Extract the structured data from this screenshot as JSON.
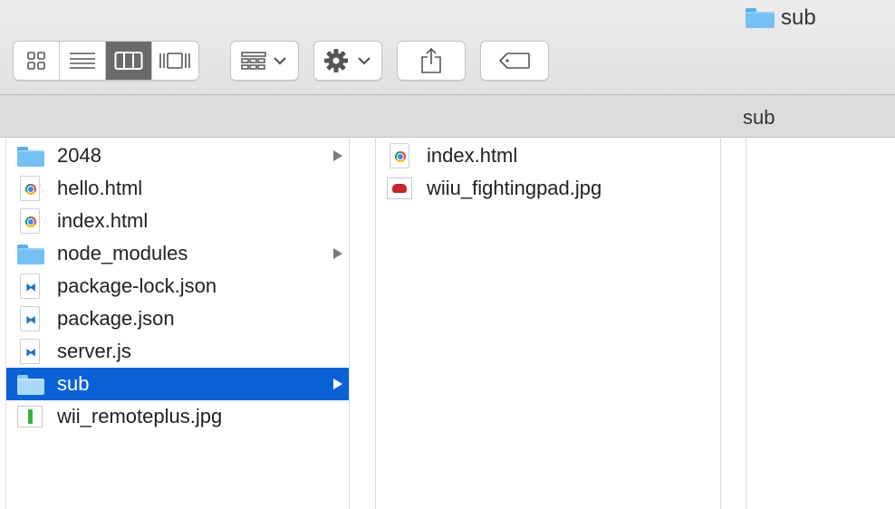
{
  "window": {
    "title": "sub"
  },
  "toolbar": {
    "view_buttons": [
      {
        "name": "icon-view",
        "icon": "grid-icon",
        "active": false
      },
      {
        "name": "list-view",
        "icon": "list-icon",
        "active": false
      },
      {
        "name": "column-view",
        "icon": "columns-icon",
        "active": true
      },
      {
        "name": "cover-flow-view",
        "icon": "coverflow-icon",
        "active": false
      }
    ],
    "group_icon": "group-by-icon",
    "action_icon": "gear-icon",
    "share_icon": "share-icon",
    "tag_icon": "tag-icon"
  },
  "pathbar": {
    "label": "sub"
  },
  "columns": [
    {
      "items": [
        {
          "label": "2048",
          "kind": "folder",
          "has_children": true,
          "selected": false
        },
        {
          "label": "hello.html",
          "kind": "html",
          "has_children": false,
          "selected": false
        },
        {
          "label": "index.html",
          "kind": "html",
          "has_children": false,
          "selected": false
        },
        {
          "label": "node_modules",
          "kind": "folder",
          "has_children": true,
          "selected": false
        },
        {
          "label": "package-lock.json",
          "kind": "vscode",
          "has_children": false,
          "selected": false
        },
        {
          "label": "package.json",
          "kind": "vscode",
          "has_children": false,
          "selected": false
        },
        {
          "label": "server.js",
          "kind": "vscode",
          "has_children": false,
          "selected": false
        },
        {
          "label": "sub",
          "kind": "folder",
          "has_children": true,
          "selected": true
        },
        {
          "label": "wii_remoteplus.jpg",
          "kind": "image",
          "has_children": false,
          "selected": false
        }
      ]
    },
    {
      "items": [
        {
          "label": "index.html",
          "kind": "html",
          "has_children": false,
          "selected": false
        },
        {
          "label": "wiiu_fightingpad.jpg",
          "kind": "image",
          "has_children": false,
          "selected": false
        }
      ]
    }
  ],
  "colors": {
    "selection": "#0a62d6",
    "folder": "#74c0f4",
    "toolbar": "#e6e6e6"
  }
}
